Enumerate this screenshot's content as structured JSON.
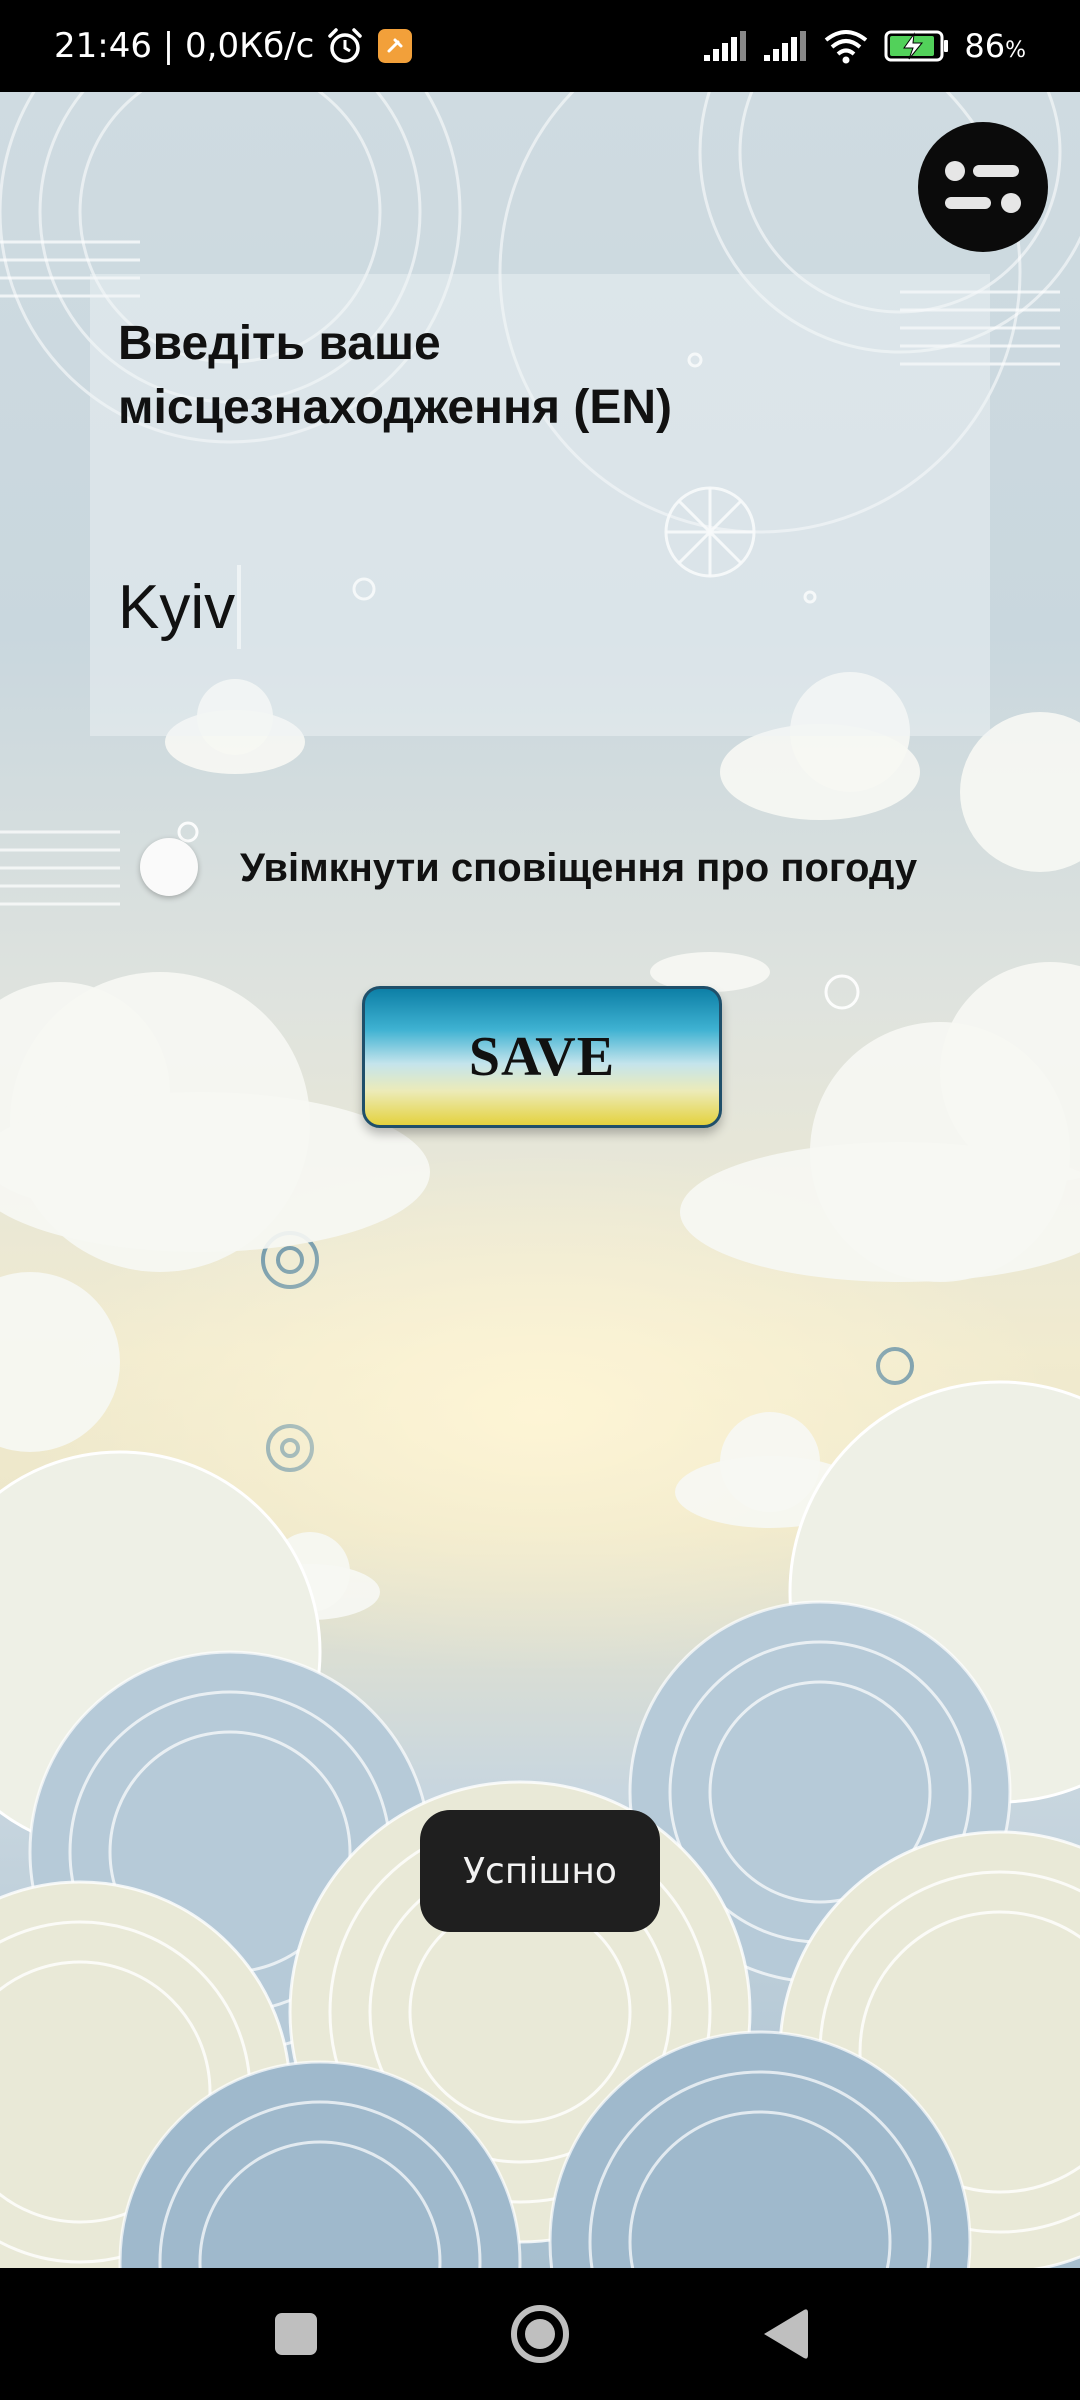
{
  "status_bar": {
    "time_speed": "21:46 | 0,0Кб/с",
    "alarm_icon": "alarm-clock-icon",
    "notification_icon": "app-notification-icon",
    "battery_percent": "86",
    "battery_unit": "%"
  },
  "header": {
    "menu_icon": "settings-sliders-icon"
  },
  "location": {
    "label": "Введіть ваше місцезнаходження (EN)",
    "value": "Kyiv"
  },
  "notifications": {
    "toggle_label": "Увімкнути сповіщення про погоду",
    "enabled": false
  },
  "save_button": {
    "label": "SAVE"
  },
  "toast": {
    "message": "Успішно"
  },
  "nav_bar": {
    "recents_icon": "square-recents-icon",
    "home_icon": "circle-home-icon",
    "back_icon": "triangle-back-icon"
  }
}
